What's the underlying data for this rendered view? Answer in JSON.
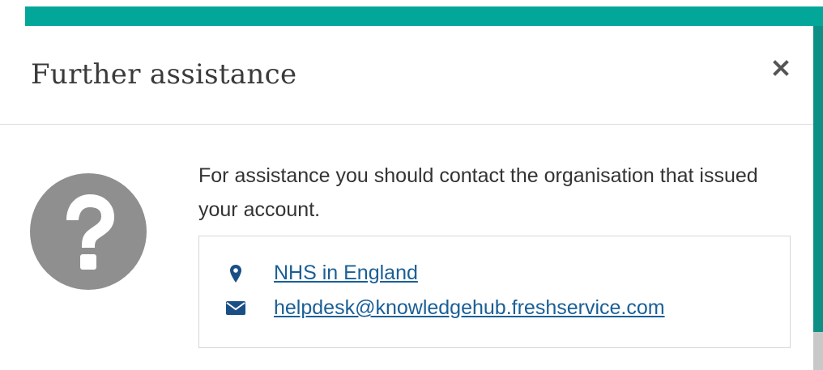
{
  "dialog": {
    "title": "Further assistance",
    "close_icon": "close-icon",
    "help_icon": "question-circle-icon",
    "message": "For assistance you should contact the organisation that issued your account.",
    "contacts": [
      {
        "icon": "map-marker-icon",
        "text": "NHS in England"
      },
      {
        "icon": "envelope-icon",
        "text": "helpdesk@knowledgehub.freshservice.com"
      }
    ]
  },
  "colors": {
    "header_bar": "#02a79a",
    "link": "#1a5f96",
    "help_icon": "#8f8f8f"
  }
}
